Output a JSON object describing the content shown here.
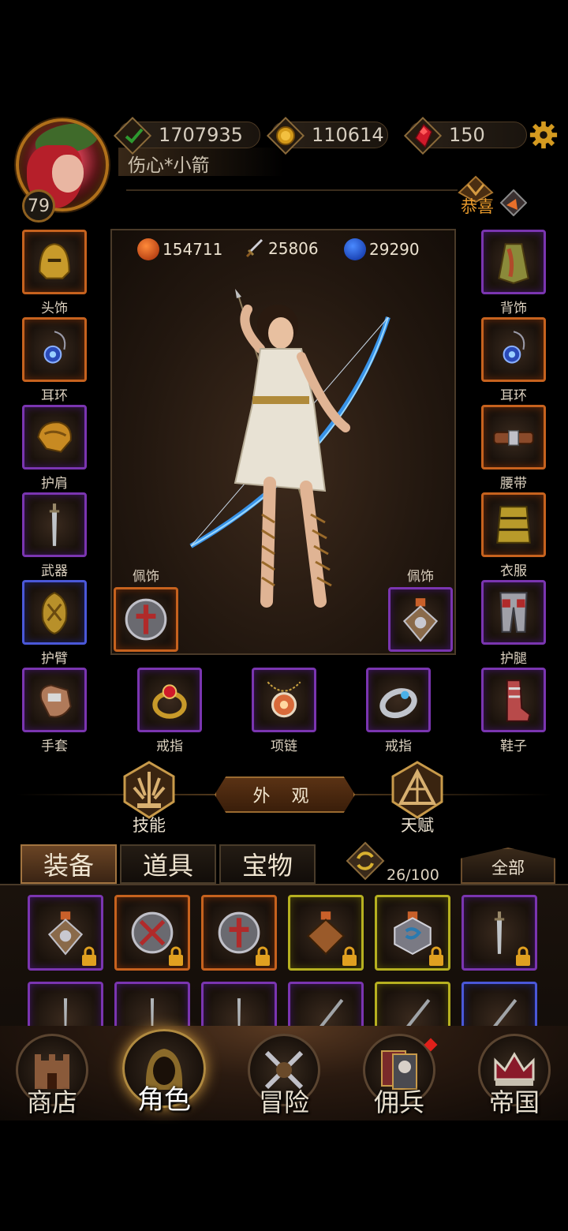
{
  "player": {
    "name": "伤心*小箭",
    "level": "79"
  },
  "resources": {
    "power": "1707935",
    "gold": "110614",
    "gems": "150"
  },
  "notice": {
    "congrats": "恭喜"
  },
  "stats": {
    "hp": "154711",
    "attack": "25806",
    "mana": "29290"
  },
  "slots": {
    "head": "头饰",
    "earring_left": "耳环",
    "shoulder": "护肩",
    "weapon": "武器",
    "bracer": "护臂",
    "gloves": "手套",
    "ring_left": "戒指",
    "necklace": "项链",
    "ring_right": "戒指",
    "shoes": "鞋子",
    "back": "背饰",
    "earring_right": "耳环",
    "belt": "腰带",
    "clothes": "衣服",
    "leggings": "护腿",
    "accessory_left": "佩饰",
    "accessory_right": "佩饰"
  },
  "actions": {
    "skills": "技能",
    "appearance": "外 观",
    "talent": "天赋"
  },
  "inventory_tabs": [
    "装备",
    "道具",
    "宝物"
  ],
  "inventory": {
    "count": "26/100",
    "filter": "全部"
  },
  "nav": [
    "商店",
    "角色",
    "冒险",
    "佣兵",
    "帝国"
  ],
  "colors": {
    "orange_rarity": "#c6621e",
    "purple_rarity": "#7a35b0",
    "blue_rarity": "#4a58d8",
    "yellow_rarity": "#b6b020",
    "accent_gold": "#e89a2c"
  }
}
